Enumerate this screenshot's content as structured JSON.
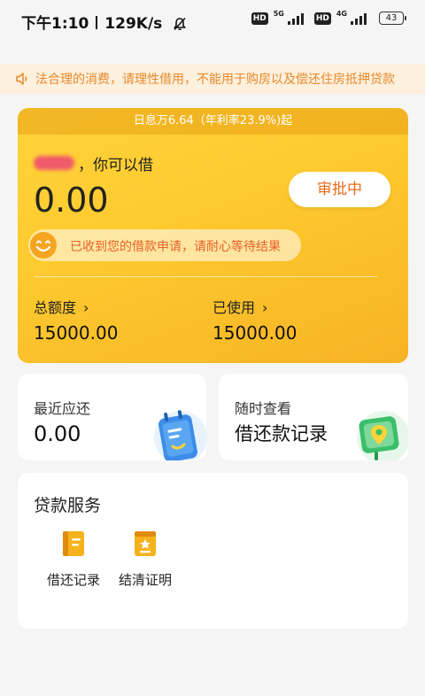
{
  "status_bar": {
    "time": "下午1:10",
    "speed": "129K/s",
    "hd1": "HD",
    "net1": "5G",
    "hd2": "HD",
    "net2": "4G",
    "battery": "43"
  },
  "notice": {
    "text": "法合理的消费，请理性借用，不能用于购房以及偿还住房抵押贷款"
  },
  "loan_card": {
    "rate_text": "日息万6.64（年利率23.9%)起",
    "greeting": "，你可以借",
    "available_amount": "0.00",
    "status_button": "审批中",
    "notice_pill": "已收到您的借款申请，请耐心等待结果",
    "total_label": "总额度",
    "total_value": "15000.00",
    "used_label": "已使用",
    "used_value": "15000.00"
  },
  "repay_card": {
    "title": "最近应还",
    "value": "0.00"
  },
  "records_card": {
    "title": "随时查看",
    "subtitle": "借还款记录"
  },
  "services": {
    "title": "贷款服务",
    "items": [
      {
        "label": "借还记录",
        "icon": "record-book-icon"
      },
      {
        "label": "结清证明",
        "icon": "certificate-icon"
      }
    ]
  },
  "colors": {
    "accent": "#fdc92e",
    "status_text": "#e86b1a",
    "notice_text": "#e8892b",
    "notice_bg": "#fdf0dc"
  }
}
